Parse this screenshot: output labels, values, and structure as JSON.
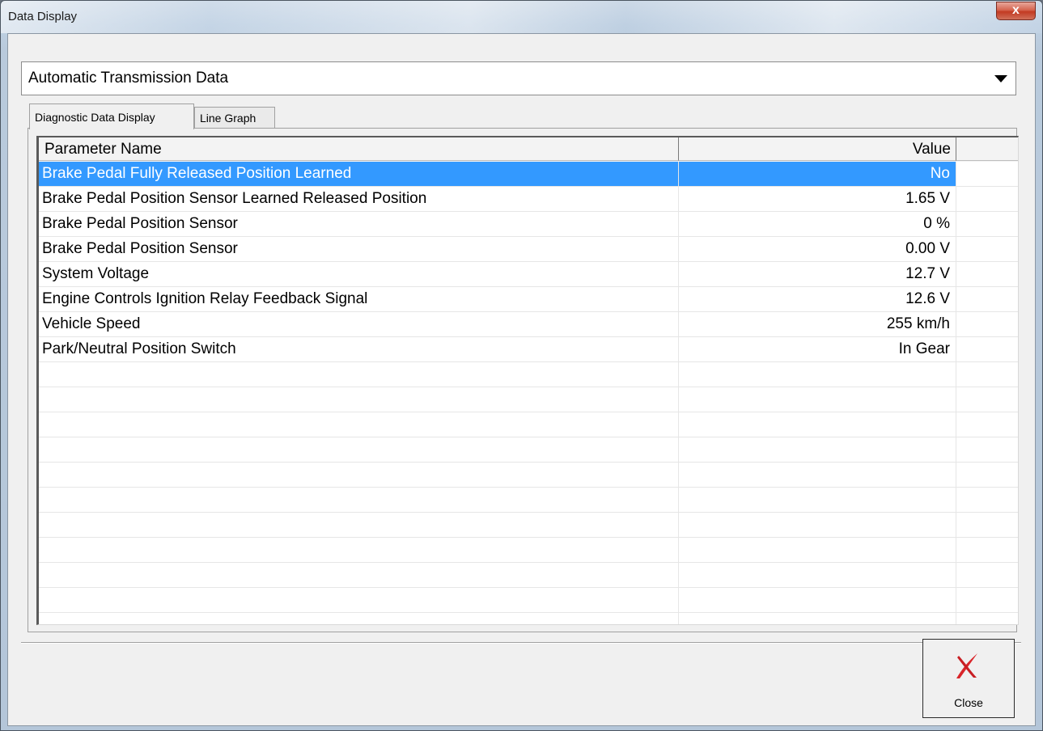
{
  "window": {
    "title": "Data Display",
    "close_glyph": "x"
  },
  "selector": {
    "value": "Automatic Transmission Data",
    "icon": "chevron-down-icon"
  },
  "tabs": [
    {
      "label": "Diagnostic Data Display",
      "active": true
    },
    {
      "label": "Line Graph",
      "active": false
    }
  ],
  "table": {
    "columns": {
      "name": "Parameter Name",
      "value": "Value"
    },
    "rows": [
      {
        "name": "Brake Pedal Fully Released Position Learned",
        "value": "No",
        "selected": true
      },
      {
        "name": "Brake Pedal Position Sensor Learned Released Position",
        "value": "1.65 V"
      },
      {
        "name": "Brake Pedal Position Sensor",
        "value": "0 %"
      },
      {
        "name": "Brake Pedal Position Sensor",
        "value": "0.00 V"
      },
      {
        "name": "System Voltage",
        "value": "12.7 V"
      },
      {
        "name": "Engine Controls Ignition Relay Feedback Signal",
        "value": "12.6 V"
      },
      {
        "name": "Vehicle Speed",
        "value": "255 km/h"
      },
      {
        "name": "Park/Neutral Position Switch",
        "value": "In Gear"
      },
      {
        "name": "",
        "value": ""
      },
      {
        "name": "",
        "value": ""
      },
      {
        "name": "",
        "value": ""
      },
      {
        "name": "",
        "value": ""
      },
      {
        "name": "",
        "value": ""
      },
      {
        "name": "",
        "value": ""
      },
      {
        "name": "",
        "value": ""
      },
      {
        "name": "",
        "value": ""
      },
      {
        "name": "",
        "value": ""
      },
      {
        "name": "",
        "value": ""
      },
      {
        "name": "",
        "value": ""
      }
    ]
  },
  "buttons": {
    "close_label": "Close",
    "close_icon": "close-x-icon"
  },
  "colors": {
    "selection": "#3399ff",
    "close_icon": "#d9252a"
  }
}
